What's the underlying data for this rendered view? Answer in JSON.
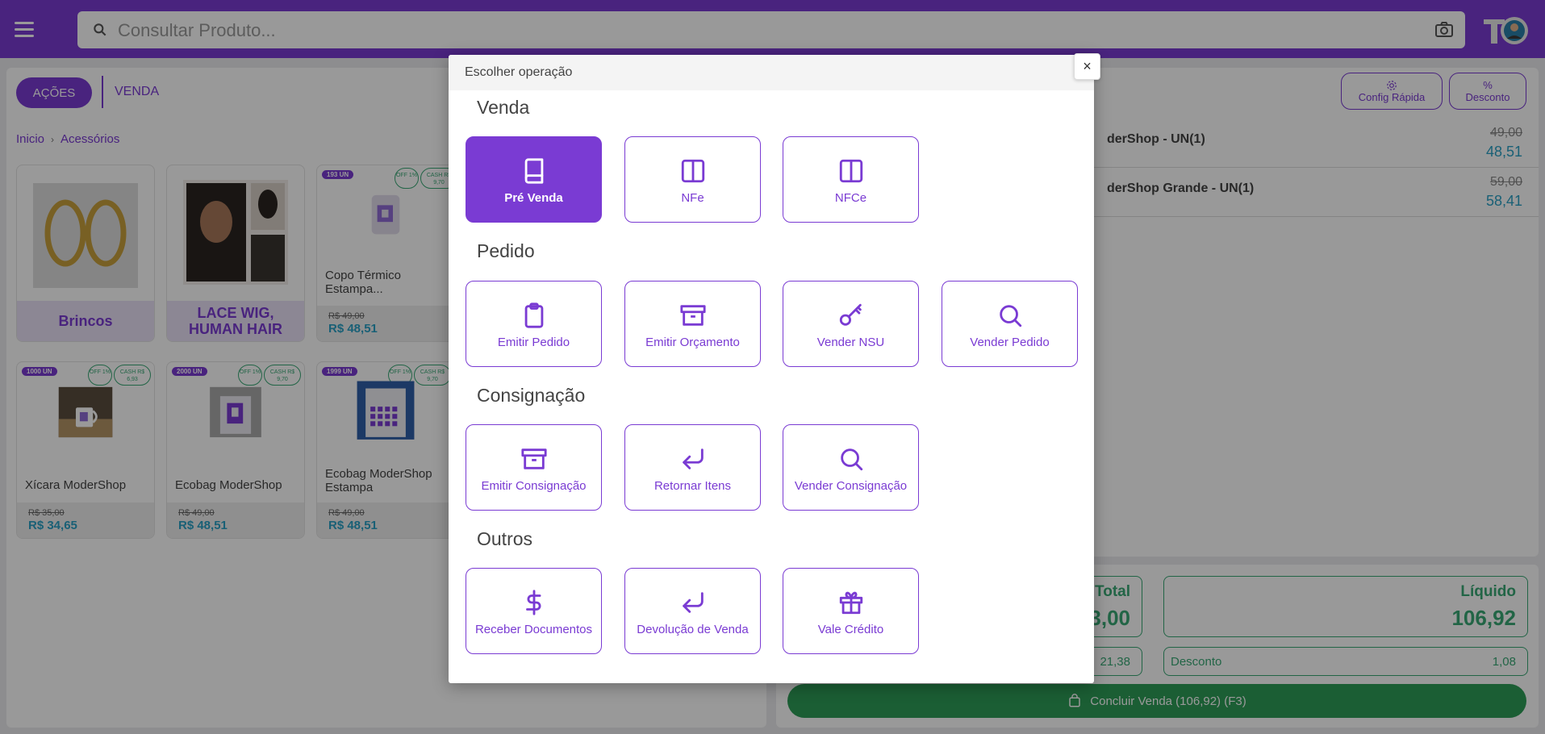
{
  "topbar": {
    "search_placeholder": "Consultar Produto..."
  },
  "left": {
    "acoes_label": "AÇÕES",
    "venda_tab": "VENDA",
    "breadcrumb": [
      "Inicio",
      "Acessórios"
    ],
    "products": [
      {
        "name": "Brincos",
        "style": "label"
      },
      {
        "name": "LACE WIG, HUMAN HAIR",
        "style": "label"
      },
      {
        "name": "Copo Térmico Estampa...",
        "badge_un": "193 UN",
        "off": "OFF 1%",
        "cash": "CASH R$ 9,70",
        "old": "R$ 49,00",
        "new": "R$ 48,51"
      },
      {
        "name": "Xícara ModerShop",
        "badge_un": "1000 UN",
        "off": "OFF 1%",
        "cash": "CASH R$ 6,93",
        "old": "R$ 35,00",
        "new": "R$ 34,65"
      },
      {
        "name": "Ecobag ModerShop",
        "badge_un": "2000 UN",
        "off": "OFF 1%",
        "cash": "CASH R$ 9,70",
        "old": "R$ 49,00",
        "new": "R$ 48,51"
      },
      {
        "name": "Ecobag ModerShop Estampa",
        "badge_un": "1999 UN",
        "off": "OFF 1%",
        "cash": "CASH R$ 9,70",
        "old": "R$ 49,00",
        "new": "R$ 48,51"
      }
    ]
  },
  "right": {
    "config_rapida": "Config Rápida",
    "desconto_btn": "Desconto",
    "cart": [
      {
        "name": "derShop - UN(1)",
        "old": "49,00",
        "new": "48,51"
      },
      {
        "name": "derShop Grande - UN(1)",
        "old": "59,00",
        "new": "58,41"
      }
    ],
    "total_label": "Total",
    "total_value": "3,00",
    "liquido_label": "Líquido",
    "liquido_value": "106,92",
    "acrescimo_value": "21,38",
    "desconto_label": "Desconto",
    "desconto_value": "1,08",
    "concluir": "Concluir Venda (106,92) (F3)"
  },
  "modal": {
    "title": "Escolher operação",
    "close": "×",
    "sections": [
      {
        "title": "Venda",
        "ops": [
          {
            "label": "Pré Venda",
            "icon": "book-icon",
            "active": true
          },
          {
            "label": "NFe",
            "icon": "columns-icon"
          },
          {
            "label": "NFCe",
            "icon": "columns-icon"
          }
        ]
      },
      {
        "title": "Pedido",
        "ops": [
          {
            "label": "Emitir Pedido",
            "icon": "clipboard-icon"
          },
          {
            "label": "Emitir Orçamento",
            "icon": "archive-icon"
          },
          {
            "label": "Vender NSU",
            "icon": "key-icon"
          },
          {
            "label": "Vender Pedido",
            "icon": "search-icon"
          }
        ]
      },
      {
        "title": "Consignação",
        "ops": [
          {
            "label": "Emitir Consignação",
            "icon": "archive-icon"
          },
          {
            "label": "Retornar Itens",
            "icon": "return-icon"
          },
          {
            "label": "Vender Consignação",
            "icon": "search-icon"
          }
        ]
      },
      {
        "title": "Outros",
        "ops": [
          {
            "label": "Receber Documentos",
            "icon": "dollar-icon"
          },
          {
            "label": "Devolução de Venda",
            "icon": "return-icon"
          },
          {
            "label": "Vale Crédito",
            "icon": "gift-icon"
          }
        ]
      }
    ]
  },
  "colors": {
    "brand": "#7a3bd3",
    "green": "#3aa876",
    "price_blue": "#2aa0c5"
  }
}
